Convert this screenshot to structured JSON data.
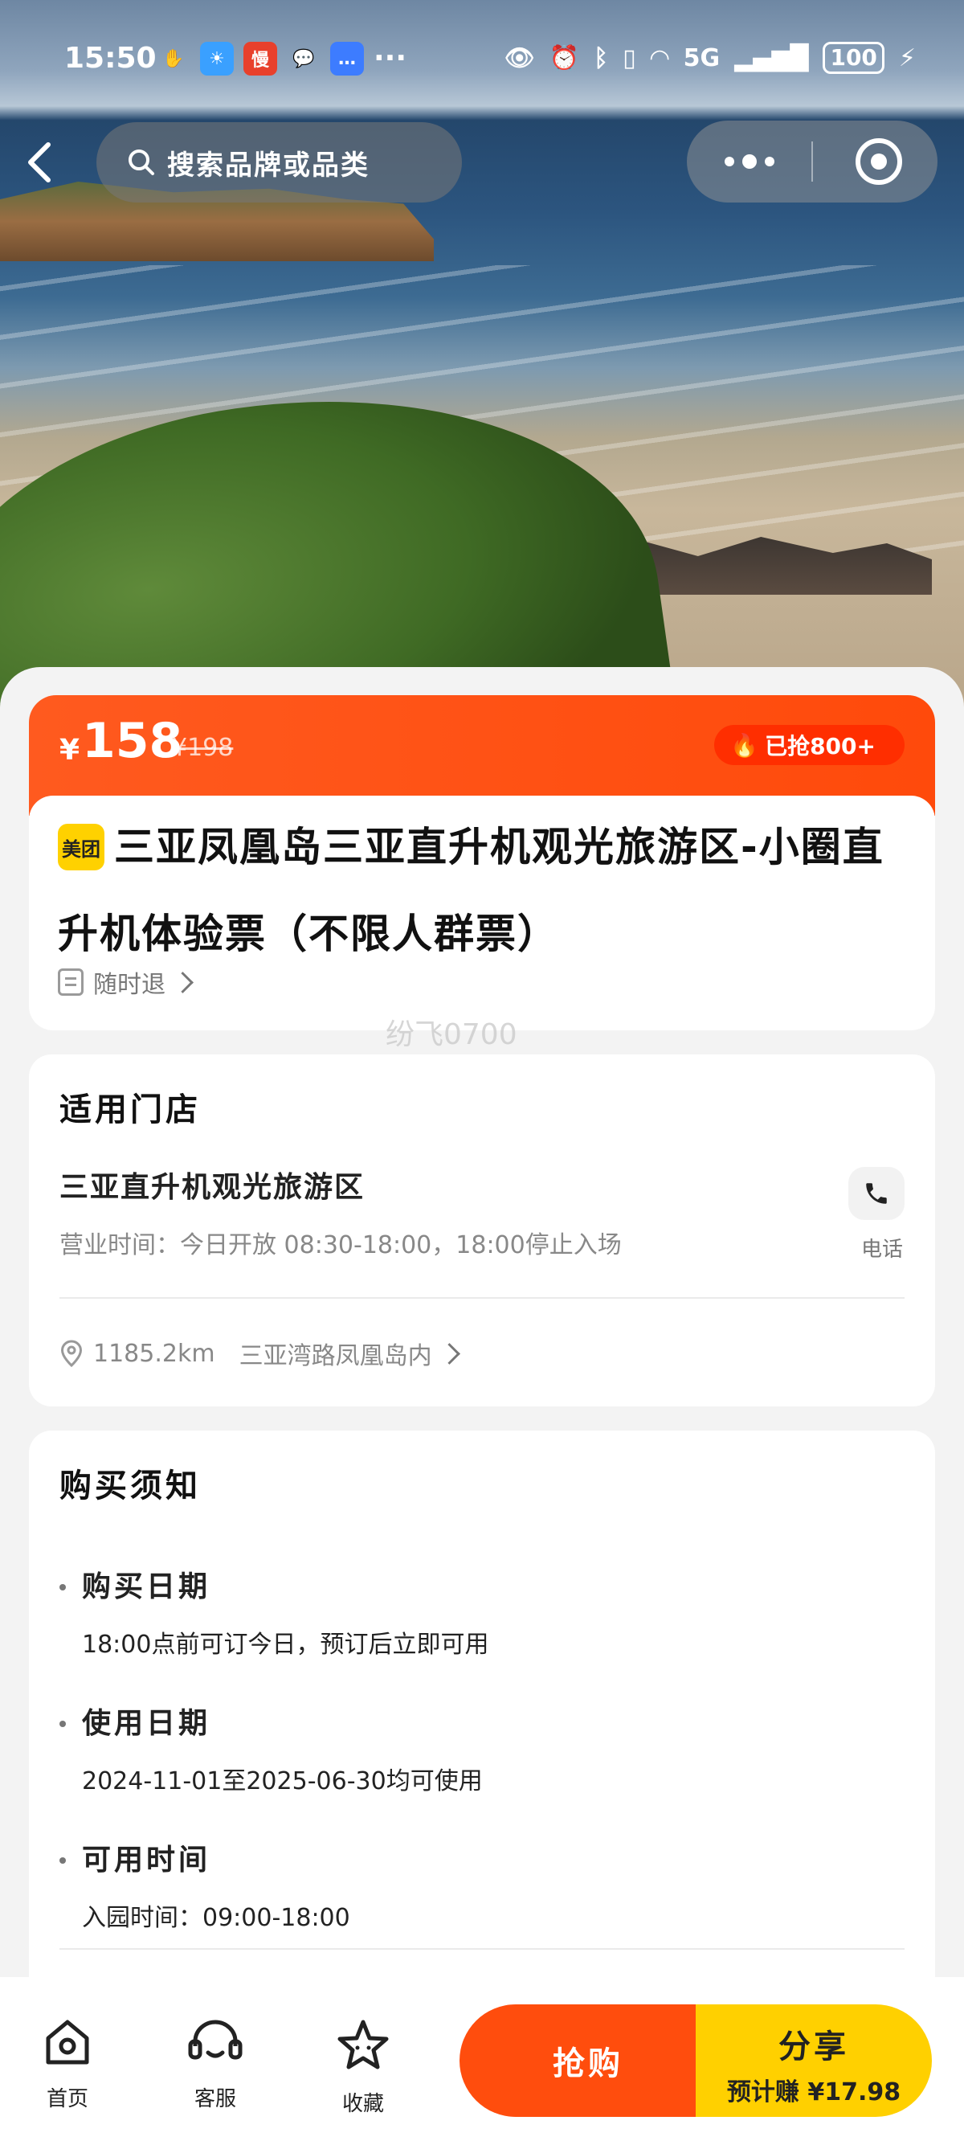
{
  "status_bar": {
    "time": "15:50",
    "dots": "···",
    "network": "5G",
    "battery": "100"
  },
  "nav": {
    "search_placeholder": "搜索品牌或品类"
  },
  "price": {
    "currency": "¥",
    "current": "158",
    "original": "¥198",
    "sold": "已抢800+"
  },
  "product": {
    "brand_logo": "美团",
    "title": "三亚凤凰岛三亚直升机观光旅游区-小圈直升机体验票（不限人群票）",
    "refund": "随时退"
  },
  "watermark": "纷飞0700",
  "store": {
    "section_title": "适用门店",
    "name": "三亚直升机观光旅游区",
    "hours": "营业时间：今日开放 08:30-18:00，18:00停止入场",
    "phone_label": "电话",
    "distance": "1185.2km",
    "address": "三亚湾路凤凰岛内"
  },
  "notice": {
    "section_title": "购买须知",
    "items": [
      {
        "label": "购买日期",
        "value": "18:00点前可订今日，预订后立即可用"
      },
      {
        "label": "使用日期",
        "value": "2024-11-01至2025-06-30均可使用"
      },
      {
        "label": "可用时间",
        "value": "入园时间：09:00-18:00"
      }
    ]
  },
  "bottom_bar": {
    "tabs": [
      {
        "label": "首页",
        "icon": "home-icon"
      },
      {
        "label": "客服",
        "icon": "headset-icon"
      },
      {
        "label": "收藏",
        "icon": "star-icon"
      }
    ],
    "buy_label": "抢购",
    "share_label": "分享",
    "share_earn": "预计赚 ¥17.98"
  },
  "colors": {
    "accent_orange": "#ff4d0d",
    "accent_yellow": "#ffd000",
    "meituan_yellow": "#ffd100"
  }
}
